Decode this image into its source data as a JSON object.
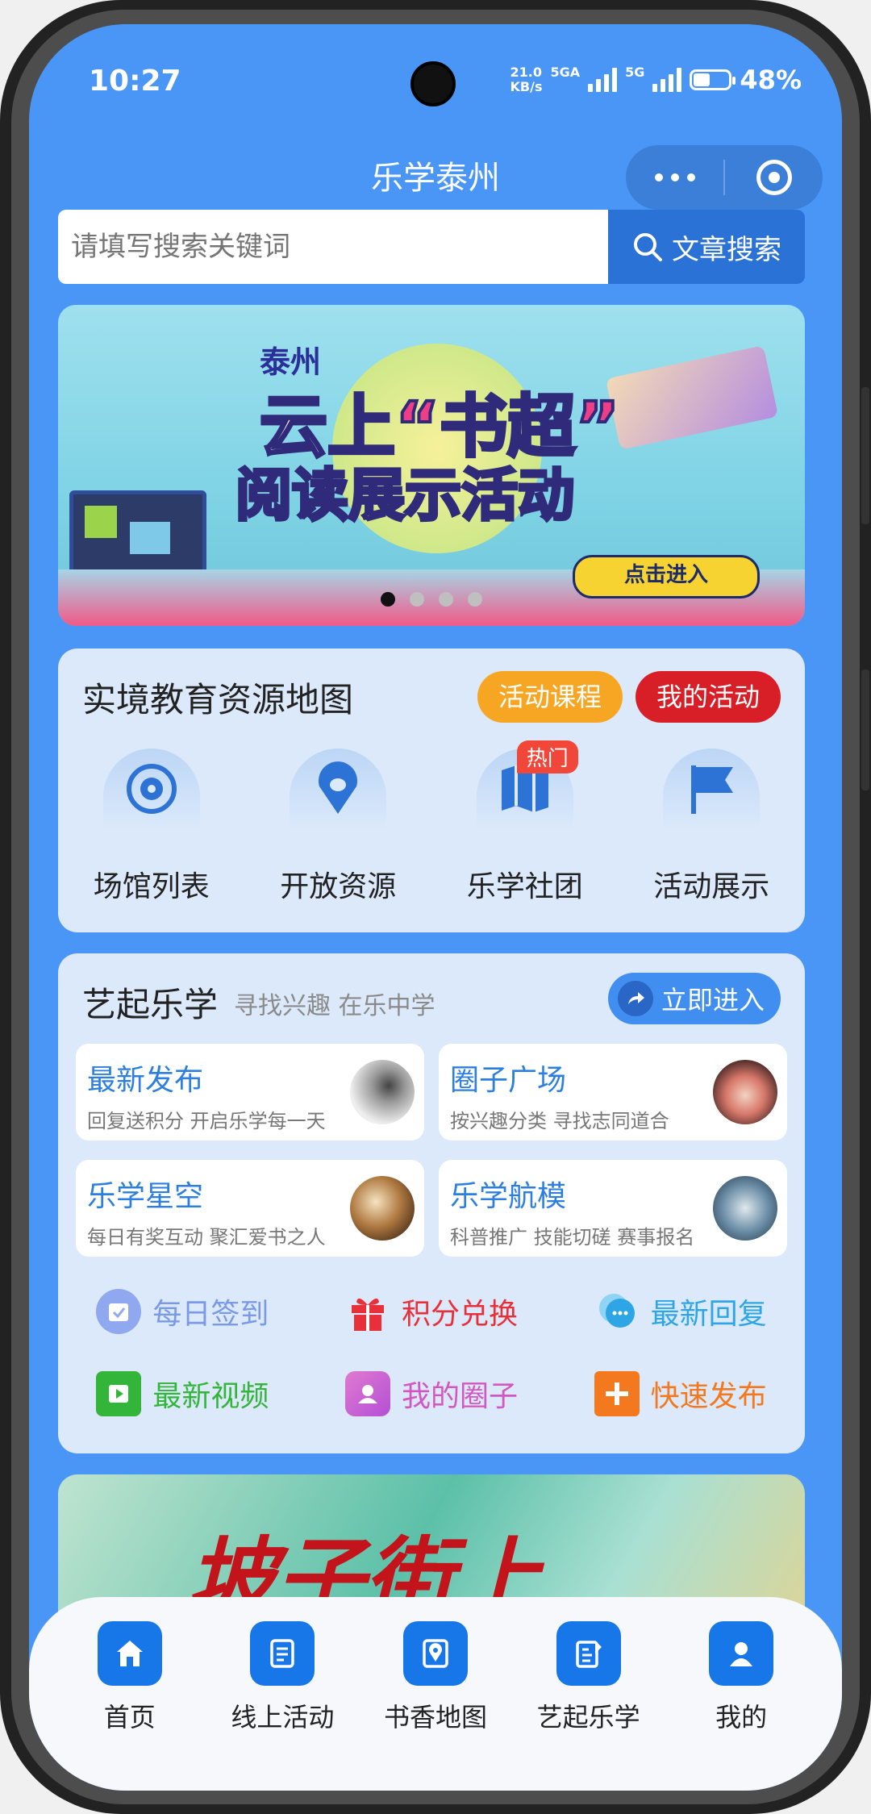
{
  "status": {
    "time": "10:27",
    "net_speed": "21.0",
    "net_unit": "KB/s",
    "sig1": "5GA",
    "sig2": "5G",
    "battery": "48%"
  },
  "header": {
    "title": "乐学泰州"
  },
  "search": {
    "placeholder": "请填写搜索关键词",
    "button": "文章搜索"
  },
  "banner": {
    "line1": "泰州",
    "line2_a": "云上",
    "line2_b": "“书超”",
    "line3": "阅读展示活动",
    "cta": "点击进入",
    "slide_count": 4,
    "active_slide": 1
  },
  "map_card": {
    "title": "实境教育资源地图",
    "pill_a": "活动课程",
    "pill_b": "我的活动",
    "items": [
      {
        "label": "场馆列表",
        "icon": "compass-icon"
      },
      {
        "label": "开放资源",
        "icon": "location-pin-icon"
      },
      {
        "label": "乐学社团",
        "icon": "map-icon",
        "badge": "热门"
      },
      {
        "label": "活动展示",
        "icon": "flag-icon"
      }
    ]
  },
  "yiqi_card": {
    "title": "艺起乐学",
    "subtitle": "寻找兴趣 在乐中学",
    "enter": "立即进入",
    "tiles": [
      {
        "title": "最新发布",
        "sub": "回复送积分 开启乐学每一天"
      },
      {
        "title": "圈子广场",
        "sub": "按兴趣分类 寻找志同道合"
      },
      {
        "title": "乐学星空",
        "sub": "每日有奖互动 聚汇爱书之人"
      },
      {
        "title": "乐学航模",
        "sub": "科普推广 技能切磋 赛事报名"
      }
    ],
    "links": [
      {
        "label": "每日签到",
        "icon": "calendar-check-icon",
        "color": "#7b9ae6"
      },
      {
        "label": "积分兑换",
        "icon": "gift-icon",
        "color": "#e8303a"
      },
      {
        "label": "最新回复",
        "icon": "chat-bubble-icon",
        "color": "#2ea6e6"
      },
      {
        "label": "最新视频",
        "icon": "video-icon",
        "color": "#33b53a"
      },
      {
        "label": "我的圈子",
        "icon": "circle-group-icon",
        "color": "#d257c2"
      },
      {
        "label": "快速发布",
        "icon": "plus-icon",
        "color": "#f4781e"
      }
    ]
  },
  "promo": {
    "title": "坡子街上"
  },
  "tabbar": [
    {
      "label": "首页",
      "icon": "home-icon"
    },
    {
      "label": "线上活动",
      "icon": "clipboard-icon"
    },
    {
      "label": "书香地图",
      "icon": "map-pin-icon"
    },
    {
      "label": "艺起乐学",
      "icon": "edit-doc-icon"
    },
    {
      "label": "我的",
      "icon": "user-icon"
    }
  ]
}
